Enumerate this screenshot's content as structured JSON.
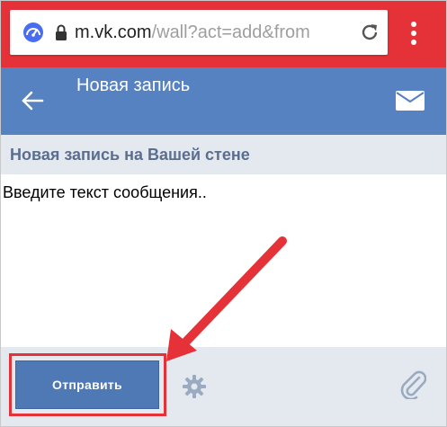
{
  "browser": {
    "url_host": "m.vk.com",
    "url_path": "/wall?act=add&from"
  },
  "header": {
    "title": "Новая запись"
  },
  "section": {
    "title": "Новая запись на Вашей стене"
  },
  "compose": {
    "placeholder": "Введите текст сообщения.."
  },
  "bottom": {
    "publish_label": "Отправить"
  },
  "colors": {
    "chrome_red": "#e53238",
    "vk_blue": "#5682c1",
    "panel_gray": "#e4e9f0",
    "section_text": "#5b6e8e",
    "highlight": "#e53238"
  },
  "icons": [
    "chrome-speed-icon",
    "lock-icon",
    "reload-icon",
    "overflow-menu-icon",
    "back-arrow-icon",
    "mail-icon",
    "gear-icon",
    "paperclip-icon"
  ]
}
